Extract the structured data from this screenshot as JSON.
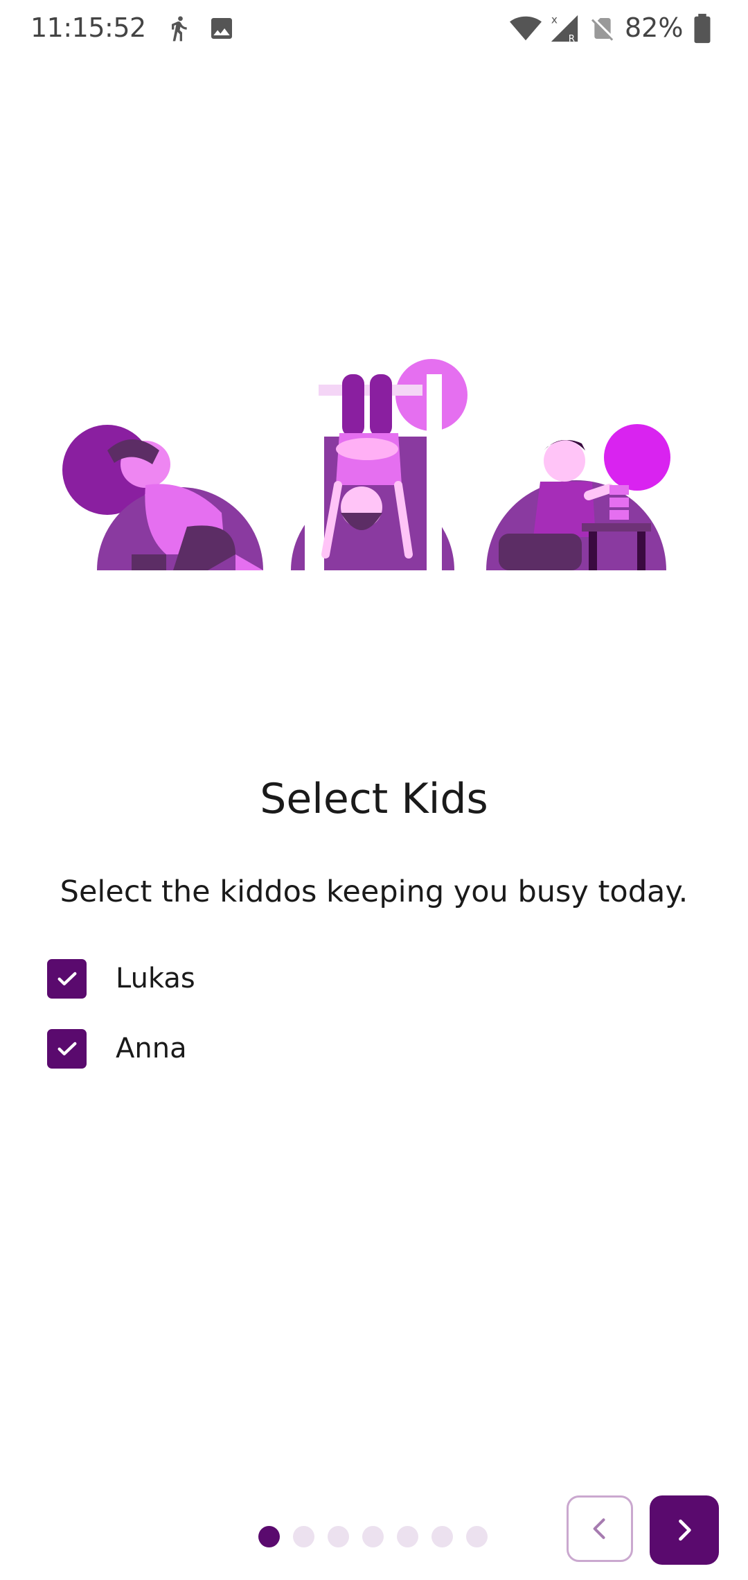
{
  "status_bar": {
    "time": "11:15:52",
    "battery_percent": "82%",
    "icons": [
      "walking-icon",
      "image-icon",
      "wifi-icon",
      "cell-signal-icon",
      "no-sim-icon",
      "battery-icon"
    ]
  },
  "onboarding": {
    "title": "Select Kids",
    "subtitle": "Select the kiddos keeping you busy today.",
    "kids": [
      {
        "label": "Lukas",
        "checked": true
      },
      {
        "label": "Anna",
        "checked": true
      }
    ]
  },
  "pagination": {
    "total": 7,
    "current": 1
  },
  "navigation": {
    "prev_icon": "chevron-left-icon",
    "next_icon": "chevron-right-icon"
  },
  "colors": {
    "accent": "#5a0a6e",
    "accent_light": "#ece1ef",
    "illustration_purple": "#8a3aa0",
    "illustration_pink": "#e56ff0"
  }
}
